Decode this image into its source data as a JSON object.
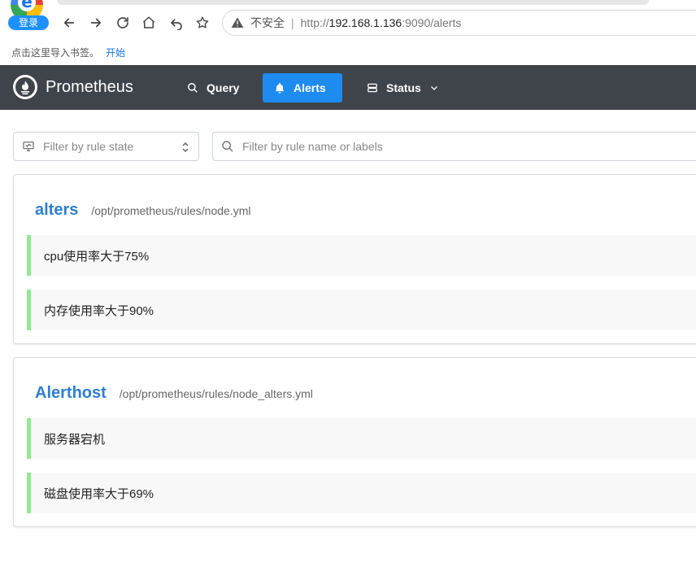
{
  "browser": {
    "login_label": "登录",
    "insecure_label": "不安全",
    "url_protocol": "http://",
    "url_host": "192.168.1.136",
    "url_rest": ":9090/alerts",
    "bookmark_hint": "点击这里导入书签。",
    "bookmark_start": "开始"
  },
  "navbar": {
    "brand": "Prometheus",
    "items": [
      {
        "label": "Query",
        "icon": "search-icon"
      },
      {
        "label": "Alerts",
        "icon": "bell-icon",
        "active": true
      },
      {
        "label": "Status",
        "icon": "server-icon"
      }
    ]
  },
  "filters": {
    "state_placeholder": "Filter by rule state",
    "name_placeholder": "Filter by rule name or labels"
  },
  "groups": [
    {
      "name": "alters",
      "file": "/opt/prometheus/rules/node.yml",
      "rules": [
        "cpu使用率大于75%",
        "内存使用率大于90%"
      ]
    },
    {
      "name": "Alerthost",
      "file": "/opt/prometheus/rules/node_alters.yml",
      "rules": [
        "服务器宕机",
        "磁盘使用率大于69%"
      ]
    }
  ],
  "colors": {
    "navbar_bg": "#3f444b",
    "active_tab": "#1e8bf0",
    "rule_border_inactive": "#90ea90",
    "group_title": "#2e7fd0"
  }
}
